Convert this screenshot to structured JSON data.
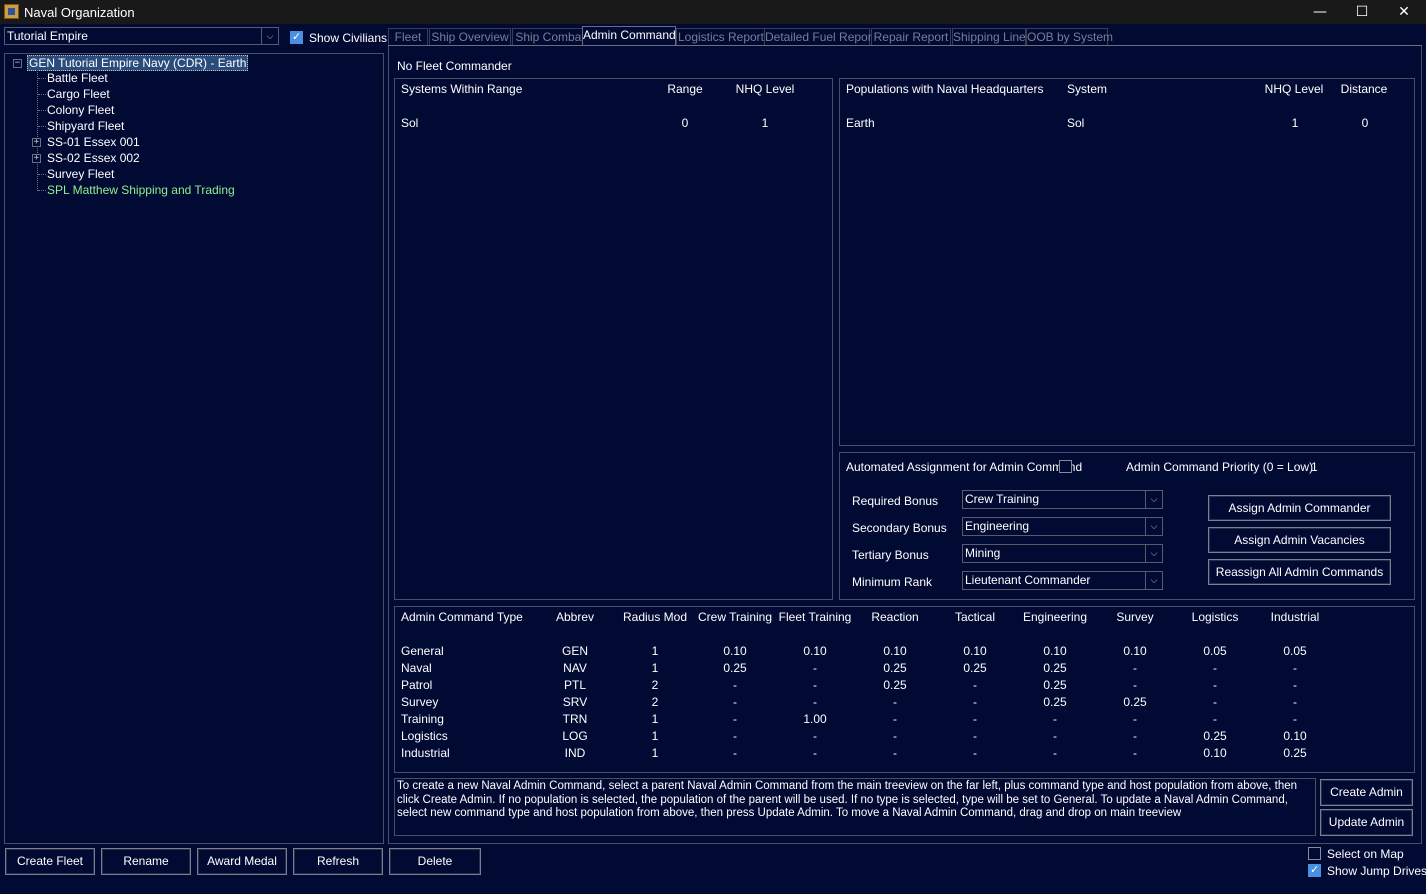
{
  "window": {
    "title": "Naval Organization",
    "minimize_glyph": "—",
    "maximize_glyph": "☐",
    "close_glyph": "✕"
  },
  "empire_select": {
    "value": "Tutorial Empire"
  },
  "show_civilians": {
    "label": "Show Civilians",
    "checked": true
  },
  "tabs": [
    "Fleet",
    "Ship Overview",
    "Ship Combat",
    "Admin Command",
    "Logistics Report",
    "Detailed Fuel Report",
    "Repair Report",
    "Shipping Line",
    "OOB by System"
  ],
  "active_tab": "Admin Command",
  "tree": {
    "root": "GEN Tutorial Empire Navy  (CDR)  -  Earth",
    "children": [
      "Battle Fleet",
      "Cargo Fleet",
      "Colony Fleet",
      "Shipyard Fleet",
      "SS-01 Essex 001",
      "SS-02 Essex 002",
      "Survey Fleet",
      "SPL Matthew Shipping and Trading"
    ],
    "expand_glyph": "+",
    "collapse_glyph": "−"
  },
  "fleet_commander": "No Fleet Commander",
  "systems_table": {
    "headers": [
      "Systems Within Range",
      "Range",
      "NHQ Level"
    ],
    "rows": [
      [
        "Sol",
        "0",
        "1"
      ]
    ]
  },
  "populations_table": {
    "headers": [
      "Populations with Naval Headquarters",
      "System",
      "NHQ Level",
      "Distance"
    ],
    "rows": [
      [
        "Earth",
        "Sol",
        "1",
        "0"
      ]
    ]
  },
  "automation": {
    "auto_label": "Automated Assignment for Admin Command",
    "auto_checked": false,
    "priority_label": "Admin Command Priority (0 = Low)",
    "priority_value": "1",
    "required_label": "Required Bonus",
    "required_value": "Crew Training",
    "secondary_label": "Secondary Bonus",
    "secondary_value": "Engineering",
    "tertiary_label": "Tertiary Bonus",
    "tertiary_value": "Mining",
    "rank_label": "Minimum Rank",
    "rank_value": "Lieutenant Commander",
    "assign_commander": "Assign Admin Commander",
    "assign_vacancies": "Assign Admin Vacancies",
    "reassign_all": "Reassign All Admin Commands"
  },
  "command_types": {
    "headers": [
      "Admin Command Type",
      "Abbrev",
      "Radius Mod",
      "Crew Training",
      "Fleet Training",
      "Reaction",
      "Tactical",
      "Engineering",
      "Survey",
      "Logistics",
      "Industrial"
    ],
    "rows": [
      [
        "General",
        "GEN",
        "1",
        "0.10",
        "0.10",
        "0.10",
        "0.10",
        "0.10",
        "0.10",
        "0.05",
        "0.05"
      ],
      [
        "Naval",
        "NAV",
        "1",
        "0.25",
        "-",
        "0.25",
        "0.25",
        "0.25",
        "-",
        "-",
        "-"
      ],
      [
        "Patrol",
        "PTL",
        "2",
        "-",
        "-",
        "0.25",
        "-",
        "0.25",
        "-",
        "-",
        "-"
      ],
      [
        "Survey",
        "SRV",
        "2",
        "-",
        "-",
        "-",
        "-",
        "0.25",
        "0.25",
        "-",
        "-"
      ],
      [
        "Training",
        "TRN",
        "1",
        "-",
        "1.00",
        "-",
        "-",
        "-",
        "-",
        "-",
        "-"
      ],
      [
        "Logistics",
        "LOG",
        "1",
        "-",
        "-",
        "-",
        "-",
        "-",
        "-",
        "0.25",
        "0.10"
      ],
      [
        "Industrial",
        "IND",
        "1",
        "-",
        "-",
        "-",
        "-",
        "-",
        "-",
        "0.10",
        "0.25"
      ]
    ]
  },
  "help_text": "To create a new Naval Admin Command, select a parent Naval Admin Command from the main treeview on the far left, plus command type and host population from above, then click Create Admin. If no population is selected, the population of the parent will be used. If no type is selected, type will be set to General. To update a Naval Admin Command, select new command type and host population from above, then press Update Admin. To move a Naval Admin Command, drag and drop on main treeview",
  "buttons": {
    "create_admin": "Create Admin",
    "update_admin": "Update Admin",
    "create_fleet": "Create Fleet",
    "rename": "Rename",
    "award_medal": "Award Medal",
    "refresh": "Refresh",
    "delete": "Delete"
  },
  "bottom_checks": {
    "select_on_map": "Select on Map",
    "select_on_map_checked": false,
    "show_jump_drives": "Show Jump Drives",
    "show_jump_drives_checked": true
  },
  "dropdown_glyph": "⌵",
  "colors": {
    "background": "#000a33",
    "border": "#4a4e64",
    "selected": "#2a4c7c",
    "civilian": "#90ee90",
    "checkbox": "#4a90e2"
  }
}
